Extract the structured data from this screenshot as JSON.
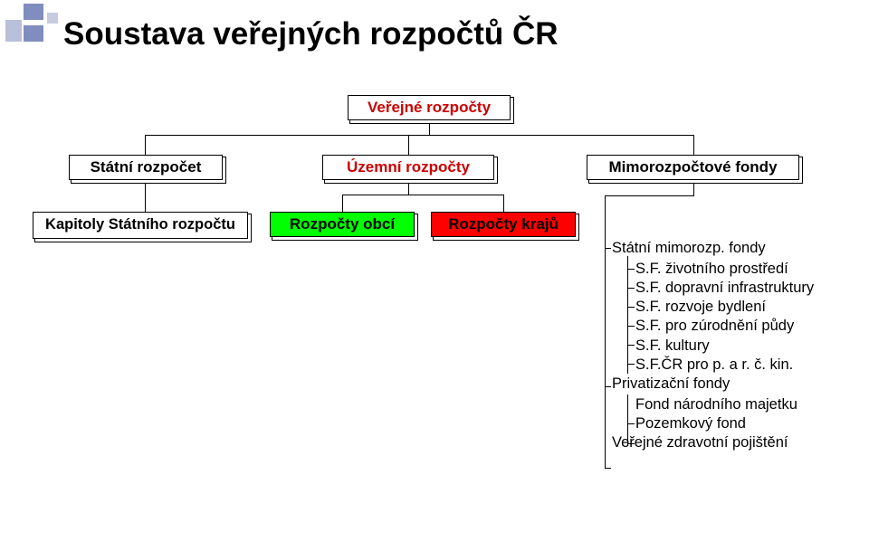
{
  "title": "Soustava veřejných rozpočtů ČR",
  "nodes": {
    "root": "Veřejné rozpočty",
    "sr": "Státní rozpočet",
    "ur": "Územní rozpočty",
    "mf": "Mimorozpočtové fondy",
    "ksr": "Kapitoly Státního rozpočtu",
    "ro": "Rozpočty obcí",
    "rk": "Rozpočty krajů"
  },
  "list": {
    "lvl0_0": "Státní mimorozp. fondy",
    "lvl1_0": "S.F. životního prostředí",
    "lvl1_1": "S.F. dopravní infrastruktury",
    "lvl1_2": "S.F. rozvoje bydlení",
    "lvl1_3": "S.F. pro zúrodnění půdy",
    "lvl1_4": "S.F. kultury",
    "lvl1_5": "S.F.ČR pro p. a r. č. kin.",
    "lvl0_1": "Privatizační fondy",
    "lvl1_6": "Fond národního majetku",
    "lvl1_7": "Pozemkový fond",
    "lvl0_2": "Veřejné zdravotní pojištění"
  },
  "chart_data": {
    "type": "diagram",
    "title": "Soustava veřejných rozpočtů ČR",
    "root": "Veřejné rozpočty",
    "children": [
      {
        "label": "Státní rozpočet",
        "children": [
          {
            "label": "Kapitoly Státního rozpočtu"
          }
        ]
      },
      {
        "label": "Územní rozpočty",
        "children": [
          {
            "label": "Rozpočty obcí"
          },
          {
            "label": "Rozpočty krajů"
          }
        ]
      },
      {
        "label": "Mimorozpočtové fondy",
        "children": [
          {
            "label": "Státní mimorozp. fondy",
            "children": [
              {
                "label": "S.F. životního prostředí"
              },
              {
                "label": "S.F. dopravní infrastruktury"
              },
              {
                "label": "S.F. rozvoje bydlení"
              },
              {
                "label": "S.F. pro zúrodnění půdy"
              },
              {
                "label": "S.F. kultury"
              },
              {
                "label": "S.F.ČR pro p. a r. č. kin."
              }
            ]
          },
          {
            "label": "Privatizační fondy",
            "children": [
              {
                "label": "Fond národního majetku"
              },
              {
                "label": "Pozemkový fond"
              }
            ]
          },
          {
            "label": "Veřejné zdravotní pojištění"
          }
        ]
      }
    ]
  }
}
